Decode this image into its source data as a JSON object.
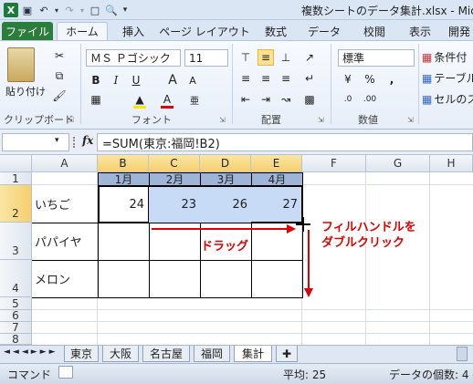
{
  "window": {
    "title": "複数シートのデータ集計.xlsx - Microsoft"
  },
  "ribbon": {
    "tabs": {
      "file": "ファイル",
      "home": "ホーム",
      "insert": "挿入",
      "page_layout": "ページ レイアウト",
      "formulas": "数式",
      "data": "データ",
      "review": "校閲",
      "view": "表示",
      "dev": "開発"
    },
    "clipboard": {
      "paste": "貼り付け",
      "label": "クリップボード"
    },
    "font": {
      "name": "ＭＳ Ｐゴシック",
      "size": "11",
      "label": "フォント"
    },
    "alignment": {
      "label": "配置"
    },
    "number": {
      "format": "標準",
      "label": "数値"
    },
    "styles": {
      "conditional": "条件付",
      "table": "テーブル",
      "cell": "セルのス"
    }
  },
  "formula_bar": {
    "fx": "fx",
    "formula": "=SUM(東京:福岡!B2)"
  },
  "grid": {
    "columns": [
      "A",
      "B",
      "C",
      "D",
      "E",
      "F",
      "G",
      "H"
    ],
    "rows": [
      "1",
      "2",
      "3",
      "4",
      "5",
      "6",
      "7",
      "8"
    ],
    "months": [
      "1月",
      "2月",
      "3月",
      "4月"
    ],
    "row2": {
      "label": "いちご",
      "values": [
        "24",
        "23",
        "26",
        "27"
      ]
    },
    "row3": {
      "label": "パパイヤ"
    },
    "row4": {
      "label": "メロン"
    }
  },
  "annotations": {
    "drag": "ドラッグ",
    "fill": "フィルハンドルを",
    "fill2": "ダブルクリック"
  },
  "sheets": {
    "tabs": [
      "東京",
      "大阪",
      "名古屋",
      "福岡",
      "集計"
    ],
    "active": "集計"
  },
  "status": {
    "mode": "コマンド",
    "average": "平均: 25",
    "count": "データの個数: 4"
  },
  "colors": {
    "accent": "#2a7d3b",
    "selection": "#c7dbf7",
    "header_band": "#9fb5d8",
    "annotation": "#e00000"
  }
}
